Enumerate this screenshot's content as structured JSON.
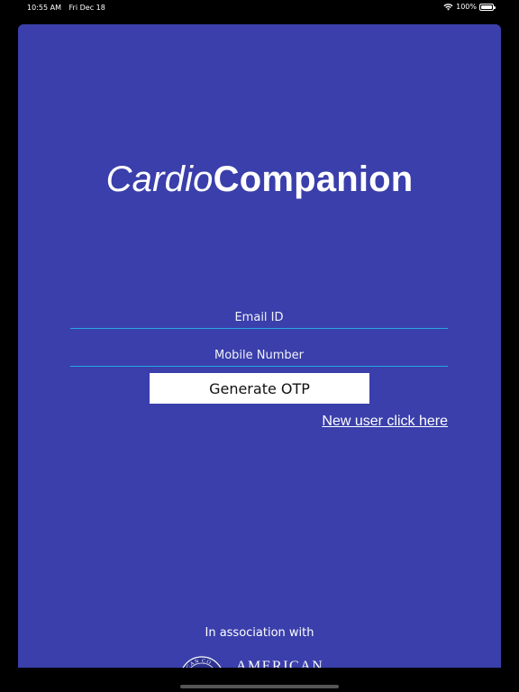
{
  "status_bar": {
    "time": "10:55 AM",
    "date": "Fri Dec 18",
    "battery": "100%",
    "wifi_icon": "wifi-icon",
    "battery_icon": "battery-full-icon"
  },
  "app": {
    "title_light": "Cardio",
    "title_bold": "Companion"
  },
  "form": {
    "email_placeholder": "Email ID",
    "email_value": "",
    "mobile_placeholder": "Mobile Number",
    "mobile_value": "",
    "submit_label": "Generate OTP",
    "new_user_link": "New user click here"
  },
  "footer": {
    "association_label": "In association with",
    "partner_name": "AMERICAN",
    "seal_text": "ICAN CO"
  },
  "colors": {
    "background": "#3a3fab",
    "field_underline": "#27a6df",
    "button_bg": "#ffffff"
  }
}
